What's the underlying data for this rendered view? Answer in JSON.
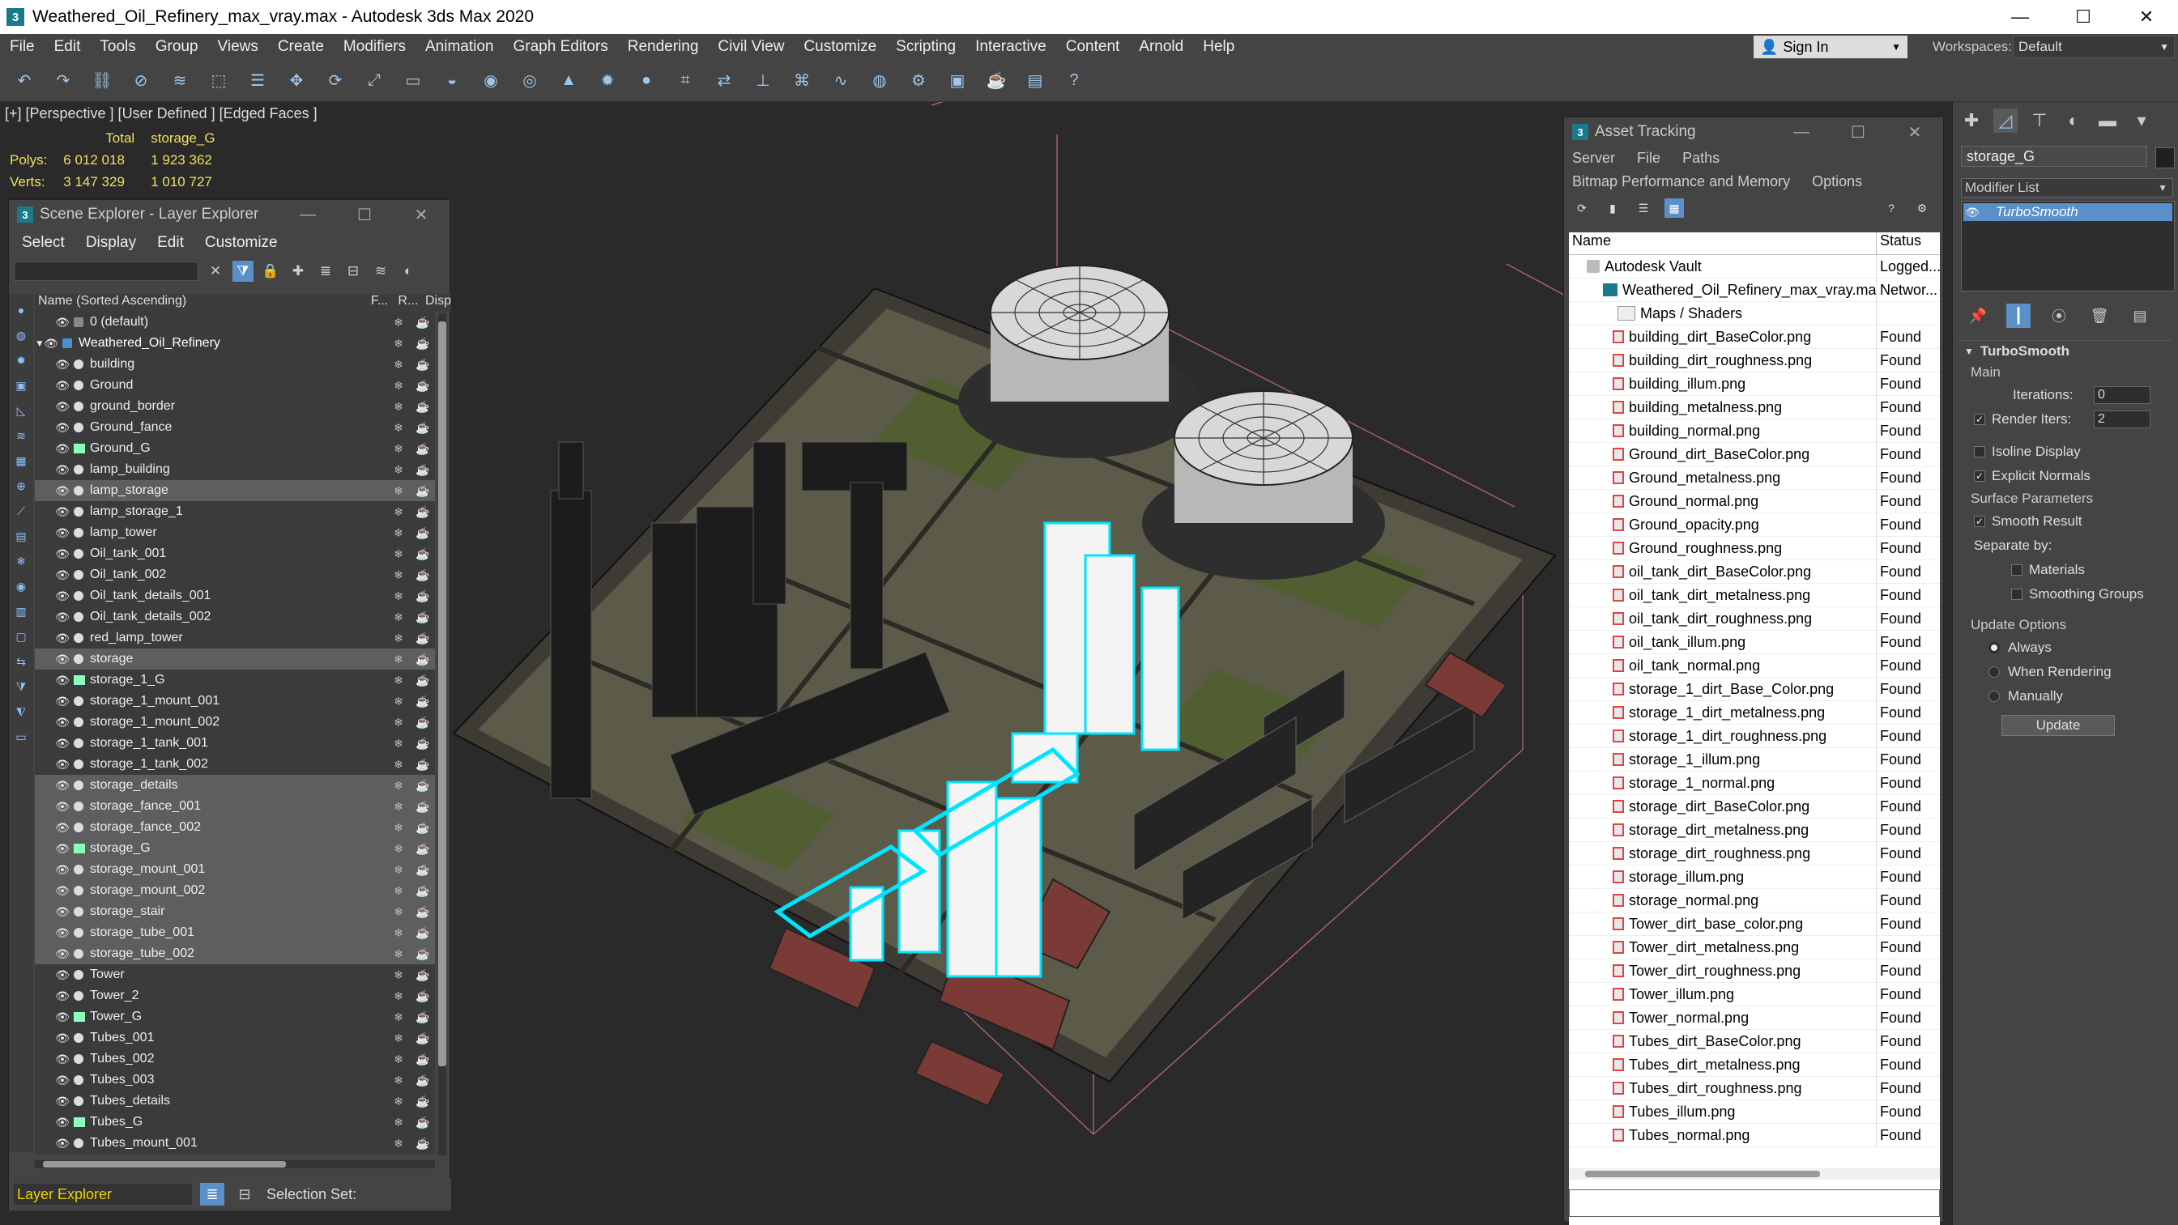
{
  "titlebar": {
    "title": "Weathered_Oil_Refinery_max_vray.max - Autodesk 3ds Max 2020",
    "minimize": "—",
    "maximize": "☐",
    "close": "✕"
  },
  "menubar": {
    "items": [
      "File",
      "Edit",
      "Tools",
      "Group",
      "Views",
      "Create",
      "Modifiers",
      "Animation",
      "Graph Editors",
      "Rendering",
      "Civil View",
      "Customize",
      "Scripting",
      "Interactive",
      "Content",
      "Arnold",
      "Help"
    ],
    "sign_in": "Sign In",
    "workspaces_label": "Workspaces:",
    "workspace_value": "Default"
  },
  "viewport": {
    "label": "[+] [Perspective ] [User Defined ] [Edged Faces ]",
    "stats": {
      "col_total": "Total",
      "col_object": "storage_G",
      "polys_label": "Polys:",
      "polys_total": "6 012 018",
      "polys_object": "1 923 362",
      "verts_label": "Verts:",
      "verts_total": "3 147 329",
      "verts_object": "1 010 727"
    }
  },
  "scene_explorer": {
    "title": "Scene Explorer - Layer Explorer",
    "menu": [
      "Select",
      "Display",
      "Edit",
      "Customize"
    ],
    "col_name": "Name (Sorted Ascending)",
    "col_frozen": "F...",
    "col_render": "R...",
    "col_display": "Disp",
    "layer_default": "0 (default)",
    "layer_main": "Weathered_Oil_Refinery",
    "objects": [
      {
        "name": "building",
        "selected": false,
        "group": false
      },
      {
        "name": "Ground",
        "selected": false,
        "group": false
      },
      {
        "name": "ground_border",
        "selected": false,
        "group": false
      },
      {
        "name": "Ground_fance",
        "selected": false,
        "group": false
      },
      {
        "name": "Ground_G",
        "selected": false,
        "group": true
      },
      {
        "name": "lamp_building",
        "selected": false,
        "group": false
      },
      {
        "name": "lamp_storage",
        "selected": true,
        "group": false
      },
      {
        "name": "lamp_storage_1",
        "selected": false,
        "group": false
      },
      {
        "name": "lamp_tower",
        "selected": false,
        "group": false
      },
      {
        "name": "Oil_tank_001",
        "selected": false,
        "group": false
      },
      {
        "name": "Oil_tank_002",
        "selected": false,
        "group": false
      },
      {
        "name": "Oil_tank_details_001",
        "selected": false,
        "group": false
      },
      {
        "name": "Oil_tank_details_002",
        "selected": false,
        "group": false
      },
      {
        "name": "red_lamp_tower",
        "selected": false,
        "group": false
      },
      {
        "name": "storage",
        "selected": true,
        "group": false
      },
      {
        "name": "storage_1_G",
        "selected": false,
        "group": true
      },
      {
        "name": "storage_1_mount_001",
        "selected": false,
        "group": false
      },
      {
        "name": "storage_1_mount_002",
        "selected": false,
        "group": false
      },
      {
        "name": "storage_1_tank_001",
        "selected": false,
        "group": false
      },
      {
        "name": "storage_1_tank_002",
        "selected": false,
        "group": false
      },
      {
        "name": "storage_details",
        "selected": true,
        "group": false
      },
      {
        "name": "storage_fance_001",
        "selected": true,
        "group": false
      },
      {
        "name": "storage_fance_002",
        "selected": true,
        "group": false
      },
      {
        "name": "storage_G",
        "selected": true,
        "group": true
      },
      {
        "name": "storage_mount_001",
        "selected": true,
        "group": false
      },
      {
        "name": "storage_mount_002",
        "selected": true,
        "group": false
      },
      {
        "name": "storage_stair",
        "selected": true,
        "group": false
      },
      {
        "name": "storage_tube_001",
        "selected": true,
        "group": false
      },
      {
        "name": "storage_tube_002",
        "selected": true,
        "group": false
      },
      {
        "name": "Tower",
        "selected": false,
        "group": false
      },
      {
        "name": "Tower_2",
        "selected": false,
        "group": false
      },
      {
        "name": "Tower_G",
        "selected": false,
        "group": true
      },
      {
        "name": "Tubes_001",
        "selected": false,
        "group": false
      },
      {
        "name": "Tubes_002",
        "selected": false,
        "group": false
      },
      {
        "name": "Tubes_003",
        "selected": false,
        "group": false
      },
      {
        "name": "Tubes_details",
        "selected": false,
        "group": false
      },
      {
        "name": "Tubes_G",
        "selected": false,
        "group": true
      },
      {
        "name": "Tubes_mount_001",
        "selected": false,
        "group": false
      }
    ],
    "explorer_name": "Layer Explorer",
    "selection_set_label": "Selection Set:"
  },
  "asset_tracking": {
    "title": "Asset Tracking",
    "menu_row1": [
      "Server",
      "File",
      "Paths"
    ],
    "menu_row2": [
      "Bitmap Performance and Memory",
      "Options"
    ],
    "col_name": "Name",
    "col_status": "Status",
    "vault": {
      "name": "Autodesk Vault",
      "status": "Logged..."
    },
    "file": {
      "name": "Weathered_Oil_Refinery_max_vray.max",
      "status": "Networ..."
    },
    "maps_folder": "Maps / Shaders",
    "maps": [
      {
        "name": "building_dirt_BaseColor.png",
        "status": "Found"
      },
      {
        "name": "building_dirt_roughness.png",
        "status": "Found"
      },
      {
        "name": "building_illum.png",
        "status": "Found"
      },
      {
        "name": "building_metalness.png",
        "status": "Found"
      },
      {
        "name": "building_normal.png",
        "status": "Found"
      },
      {
        "name": "Ground_dirt_BaseColor.png",
        "status": "Found"
      },
      {
        "name": "Ground_metalness.png",
        "status": "Found"
      },
      {
        "name": "Ground_normal.png",
        "status": "Found"
      },
      {
        "name": "Ground_opacity.png",
        "status": "Found"
      },
      {
        "name": "Ground_roughness.png",
        "status": "Found"
      },
      {
        "name": "oil_tank_dirt_BaseColor.png",
        "status": "Found"
      },
      {
        "name": "oil_tank_dirt_metalness.png",
        "status": "Found"
      },
      {
        "name": "oil_tank_dirt_roughness.png",
        "status": "Found"
      },
      {
        "name": "oil_tank_illum.png",
        "status": "Found"
      },
      {
        "name": "oil_tank_normal.png",
        "status": "Found"
      },
      {
        "name": "storage_1_dirt_Base_Color.png",
        "status": "Found"
      },
      {
        "name": "storage_1_dirt_metalness.png",
        "status": "Found"
      },
      {
        "name": "storage_1_dirt_roughness.png",
        "status": "Found"
      },
      {
        "name": "storage_1_illum.png",
        "status": "Found"
      },
      {
        "name": "storage_1_normal.png",
        "status": "Found"
      },
      {
        "name": "storage_dirt_BaseColor.png",
        "status": "Found"
      },
      {
        "name": "storage_dirt_metalness.png",
        "status": "Found"
      },
      {
        "name": "storage_dirt_roughness.png",
        "status": "Found"
      },
      {
        "name": "storage_illum.png",
        "status": "Found"
      },
      {
        "name": "storage_normal.png",
        "status": "Found"
      },
      {
        "name": "Tower_dirt_base_color.png",
        "status": "Found"
      },
      {
        "name": "Tower_dirt_metalness.png",
        "status": "Found"
      },
      {
        "name": "Tower_dirt_roughness.png",
        "status": "Found"
      },
      {
        "name": "Tower_illum.png",
        "status": "Found"
      },
      {
        "name": "Tower_normal.png",
        "status": "Found"
      },
      {
        "name": "Tubes_dirt_BaseColor.png",
        "status": "Found"
      },
      {
        "name": "Tubes_dirt_metalness.png",
        "status": "Found"
      },
      {
        "name": "Tubes_dirt_roughness.png",
        "status": "Found"
      },
      {
        "name": "Tubes_illum.png",
        "status": "Found"
      },
      {
        "name": "Tubes_normal.png",
        "status": "Found"
      }
    ]
  },
  "command_panel": {
    "object_name": "storage_G",
    "modifier_list": "Modifier List",
    "modifier": "TurboSmooth",
    "rollout_title": "TurboSmooth",
    "main_label": "Main",
    "iterations_label": "Iterations:",
    "iterations_value": "0",
    "render_iters_label": "Render Iters:",
    "render_iters_value": "2",
    "isoline_label": "Isoline Display",
    "explicit_normals_label": "Explicit Normals",
    "surface_params_label": "Surface Parameters",
    "smooth_result_label": "Smooth Result",
    "separate_by_label": "Separate by:",
    "materials_label": "Materials",
    "smoothing_groups_label": "Smoothing Groups",
    "update_options_label": "Update Options",
    "always_label": "Always",
    "when_rendering_label": "When Rendering",
    "manually_label": "Manually",
    "update_button": "Update"
  },
  "colors": {
    "accent": "#5a8fc8",
    "selection_highlight": "#00e5ff",
    "stats_text": "#f0e060",
    "panel_bg": "#444444"
  }
}
